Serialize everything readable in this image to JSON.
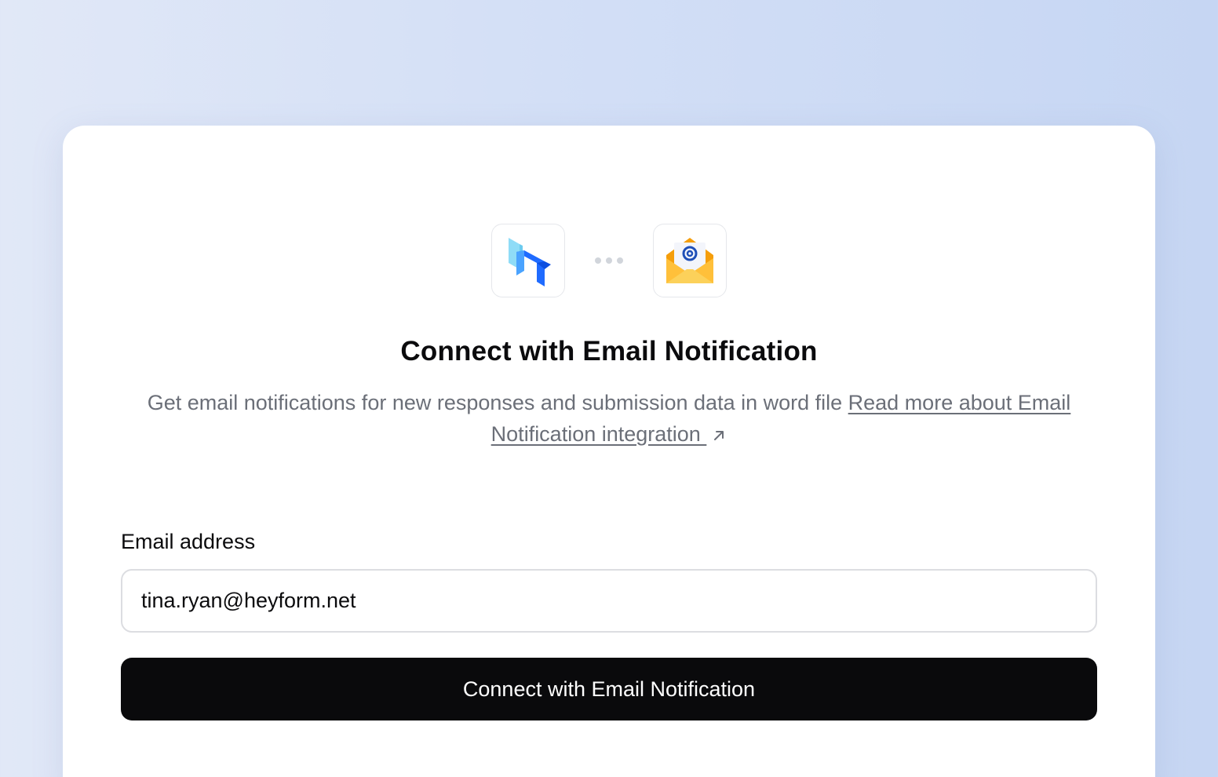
{
  "header": {
    "title": "Connect with Email Notification",
    "description": "Get email notifications for new responses and submission data in word file ",
    "learn_more_link": "Read more about Email Notification integration "
  },
  "icons": {
    "source_app": "heyform-logo-icon",
    "connector": "ellipsis-dots-icon",
    "target_app": "email-envelope-icon",
    "link_arrow": "external-link-arrow-icon"
  },
  "form": {
    "email_label": "Email address",
    "email_value": "tina.ryan@heyform.net",
    "submit_label": "Connect with Email Notification"
  },
  "colors": {
    "button_bg": "#0a0a0c",
    "brand_blue": "#1f6bff",
    "envelope_orange": "#f5a524"
  }
}
